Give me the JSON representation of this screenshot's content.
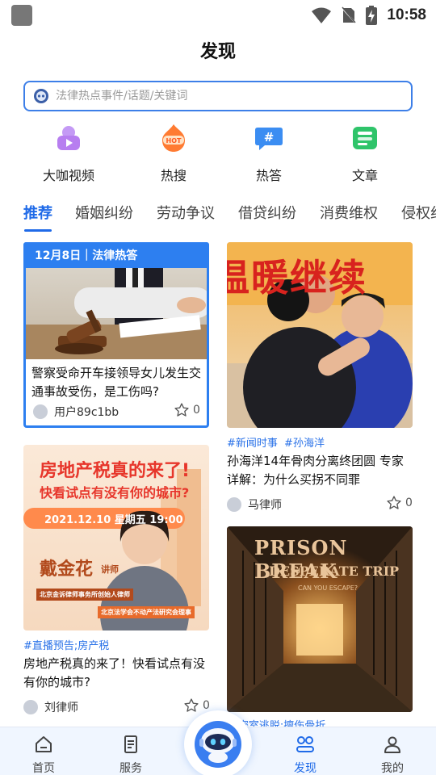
{
  "status_bar": {
    "time": "10:58"
  },
  "header": {
    "title": "发现"
  },
  "search": {
    "placeholder": "法律热点事件/话题/关键词"
  },
  "quick_links": [
    {
      "label": "大咖视频",
      "icon": "video-icon"
    },
    {
      "label": "热搜",
      "icon": "hot-icon"
    },
    {
      "label": "热答",
      "icon": "hashtag-chat-icon"
    },
    {
      "label": "文章",
      "icon": "article-icon"
    }
  ],
  "tabs": [
    "推荐",
    "婚姻纠纷",
    "劳动争议",
    "借贷纠纷",
    "消费维权",
    "侵权纠纷"
  ],
  "feed": {
    "card1": {
      "banner": "12月8日｜法律热答",
      "title": "警察受命开车接领导女儿发生交通事故受伤，是工伤吗?",
      "author": "用户89c1bb",
      "stars": "0"
    },
    "card2": {
      "image_text": "温暖继续",
      "tags": [
        "#新闻时事",
        "#孙海洋"
      ],
      "title": "孙海洋14年骨肉分离终团圆 专家详解：为什么买拐不同罪",
      "author": "马律师",
      "stars": "0"
    },
    "card3": {
      "headline": "房地产税真的来了!",
      "subheadline": "快看试点有没有你的城市?",
      "date": "2021.12.10 星期五 19:00",
      "speaker": "戴金花",
      "speaker_role": "讲师",
      "affiliation1": "北京金诉律师事务所创始人律师",
      "affiliation2": "北京法学会不动产法研究会理事",
      "tags": "#直播预告;房产税",
      "title": "房地产税真的来了！快看试点有没有你的城市?",
      "author": "刘律师",
      "stars": "0"
    },
    "card4": {
      "poster_title": "PRISON BREAK",
      "poster_subtitle": "DESPERATE TRIP",
      "poster_tagline": "CAN YOU ESCAPE?",
      "tags": "#密室逃脱;擅伤骨折"
    }
  },
  "bottom_nav": [
    {
      "label": "首页",
      "icon": "home-icon"
    },
    {
      "label": "服务",
      "icon": "service-icon"
    },
    {
      "label": "发现",
      "icon": "discover-icon"
    },
    {
      "label": "我的",
      "icon": "profile-icon"
    }
  ],
  "colors": {
    "accent": "#1f6ae8",
    "tag": "#2a72e8",
    "banner": "#2d7ff0"
  }
}
